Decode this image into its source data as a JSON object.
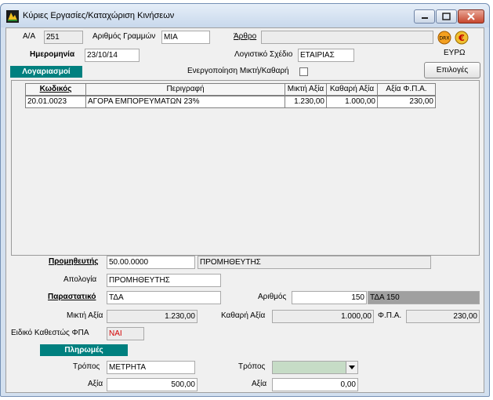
{
  "window": {
    "title": "Κύριες Εργασίες/Καταχώριση Κινήσεων"
  },
  "header": {
    "aa_label": "Α/Α",
    "aa_value": "251",
    "lines_label": "Αριθμός Γραμμών",
    "lines_value": "ΜΙΑ",
    "arthro_label": "Άρθρο",
    "arthro_value": "",
    "date_label": "Ημερομηνία",
    "date_value": "23/10/14",
    "plan_label": "Λογιστικό Σχέδιο",
    "plan_value": "ΕΤΑΙΡΙΑΣ",
    "gross_toggle_label": "Ενεργοποίηση Μικτή/Καθαρή",
    "drx_label": "DRX",
    "euro_glyph": "€",
    "currency_label": "ΕΥΡΩ",
    "options_label": "Επιλογές"
  },
  "accounts": {
    "title": "Λογαριασμοί",
    "columns": [
      "Κωδικός",
      "Περιγραφή",
      "Μικτή Αξία",
      "Καθαρή Αξία",
      "Αξία Φ.Π.Α."
    ],
    "rows": [
      {
        "code": "20.01.0023",
        "desc": "ΑΓΟΡΑ ΕΜΠΟΡΕΥΜΑΤΩΝ 23%",
        "gross": "1.230,00",
        "net": "1.000,00",
        "vat": "230,00"
      }
    ]
  },
  "supplier": {
    "label": "Προμηθευτής",
    "code": "50.00.0000",
    "name": "ΠΡΟΜΗΘΕΥΤΗΣ",
    "reason_label": "Απολογία",
    "reason_value": "ΠΡΟΜΗΘΕΥΤΗΣ"
  },
  "document": {
    "label": "Παραστατικό",
    "value": "ΤΔΑ",
    "number_label": "Αριθμός",
    "number_value": "150",
    "number_display": "ΤΔΑ 150"
  },
  "totals": {
    "gross_label": "Μικτή Αξία",
    "gross_value": "1.230,00",
    "net_label": "Καθαρή Αξία",
    "net_value": "1.000,00",
    "vat_label": "Φ.Π.Α.",
    "vat_value": "230,00",
    "vat_regime_label": "Ειδικό Καθεστώς ΦΠΑ",
    "vat_regime_value": "ΝΑΙ"
  },
  "payments": {
    "title": "Πληρωμές",
    "method1_label": "Τρόπος",
    "method1_value": "ΜΕΤΡΗΤΑ",
    "method2_label": "Τρόπος",
    "method2_value": "",
    "amount1_label": "Αξία",
    "amount1_value": "500,00",
    "amount2_label": "Αξία",
    "amount2_value": "0,00"
  },
  "colors": {
    "accent": "#00807f",
    "window_frame": "#d3e0ef",
    "close_button": "#c7472e",
    "combo_fill": "#c6dcc6"
  }
}
